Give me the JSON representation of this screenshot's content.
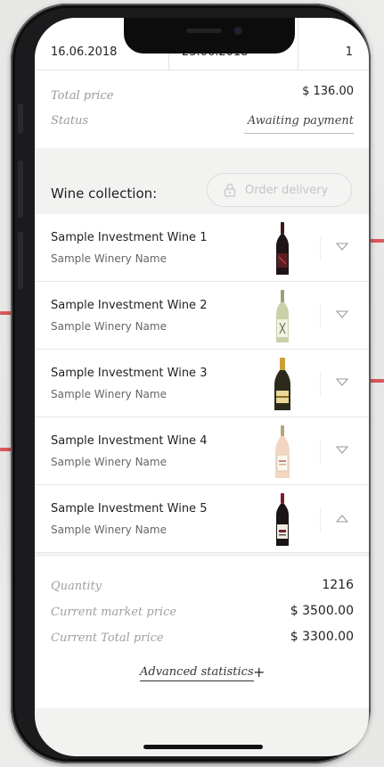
{
  "order": {
    "date_from": "16.06.2018",
    "date_to": "23.06.2018",
    "count": "1",
    "total_price_label": "Total price",
    "total_price_value": "$ 136.00",
    "status_label": "Status",
    "status_value": "Awaiting payment"
  },
  "collection": {
    "title": "Wine collection:",
    "order_delivery_label": "Order delivery",
    "items": [
      {
        "name": "Sample Investment Wine 1",
        "winery": "Sample Winery Name",
        "bottle": "red-bottle-icon",
        "expanded": false
      },
      {
        "name": "Sample Investment Wine 2",
        "winery": "Sample Winery Name",
        "bottle": "white-bottle-icon",
        "expanded": false
      },
      {
        "name": "Sample Investment Wine 3",
        "winery": "Sample Winery Name",
        "bottle": "sparkling-bottle-icon",
        "expanded": false
      },
      {
        "name": "Sample Investment Wine 4",
        "winery": "Sample Winery Name",
        "bottle": "rose-bottle-icon",
        "expanded": false
      },
      {
        "name": "Sample Investment Wine 5",
        "winery": "Sample Winery Name",
        "bottle": "red-bottle-icon",
        "expanded": true
      }
    ]
  },
  "details": {
    "quantity_label": "Quantity",
    "quantity_value": "1216",
    "market_price_label": "Current market price",
    "market_price_value": "$ 3500.00",
    "total_price_label": "Current Total price",
    "total_price_value": "$ 3300.00",
    "advanced_label": "Advanced statistics",
    "advanced_icon": "+"
  },
  "colors": {
    "accent_marker": "#d9575c",
    "phone_body": "#1b1b1d"
  }
}
